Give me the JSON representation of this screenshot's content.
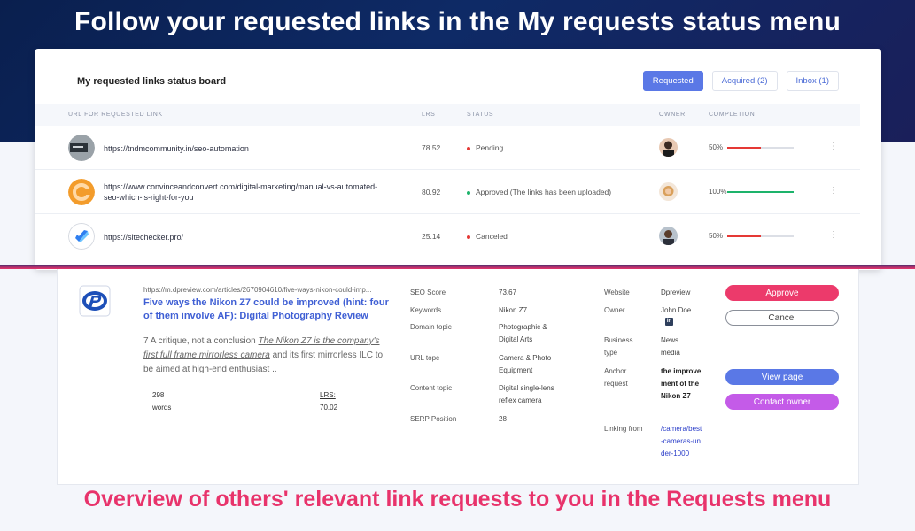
{
  "headline": "Follow your requested links in the My requests status menu",
  "board": {
    "title": "My requested links status board",
    "tabs": [
      "Requested",
      "Acquired (2)",
      "Inbox (1)"
    ],
    "columns": {
      "url": "URL FOR REQUESTED LINK",
      "lrs": "LRS",
      "status": "STATUS",
      "owner": "OWNER",
      "completion": "COMPLETION"
    },
    "rows": [
      {
        "url": "https://tndmcommunity.in/seo-automation",
        "lrs": "78.52",
        "status": "Pending",
        "status_color": "#e53935",
        "completion": "50%",
        "completion_value": 0.5,
        "bar_color": "#e53935"
      },
      {
        "url": "https://www.convinceandconvert.com/digital-marketing/manual-vs-automated-seo-which-is-right-for-you",
        "lrs": "80.92",
        "status": "Approved (The links has been uploaded)",
        "status_color": "#1db36b",
        "completion": "100%",
        "completion_value": 1.0,
        "bar_color": "#1db36b"
      },
      {
        "url": "https://sitechecker.pro/",
        "lrs": "25.14",
        "status": "Canceled",
        "status_color": "#e53935",
        "completion": "50%",
        "completion_value": 0.5,
        "bar_color": "#e53935"
      }
    ]
  },
  "request": {
    "url": "https://m.dpreview.com/articles/2670904610/five-ways-nikon-could-imp...",
    "title": "Five ways the Nikon Z7 could be improved (hint: four of them involve AF): Digital Photography Review",
    "snippet_prefix": "7 A critique, not a conclusion ",
    "snippet_highlight": "The Nikon Z7 is the company's first full frame mirrorless camera",
    "snippet_suffix": " and its first mirrorless ILC to be aimed at high-end enthusiast ..",
    "words_value": "298",
    "words_label": "words",
    "lrs_label": "LRS:",
    "lrs_value": "70.02",
    "metrics": {
      "seo_score_label": "SEO Score",
      "seo_score": "73.67",
      "keywords_label": "Keywords",
      "keywords": "Nikon Z7",
      "domain_topic_label": "Domain topic",
      "domain_topic": "Photographic & Digital Arts",
      "url_topic_label": "URL topc",
      "url_topic": "Camera & Photo Equipment",
      "content_topic_label": "Content topic",
      "content_topic": "Digital single-lens reflex camera",
      "serp_label": "SERP Position",
      "serp": "28"
    },
    "info": {
      "website_label": "Website",
      "website": "Dpreview",
      "owner_label": "Owner",
      "owner": "John Doe",
      "business_type_label": "Business type",
      "business_type": "News media",
      "anchor_label": "Anchor request",
      "anchor": "the improvement of the Nikon Z7",
      "linking_label": "Linking from",
      "linking": "/camera/best-cameras-under-1000"
    },
    "buttons": {
      "approve": "Approve",
      "cancel": "Cancel",
      "view_page": "View page",
      "contact_owner": "Contact owner"
    }
  },
  "caption": "Overview of others' relevant link requests to you in the Requests menu"
}
